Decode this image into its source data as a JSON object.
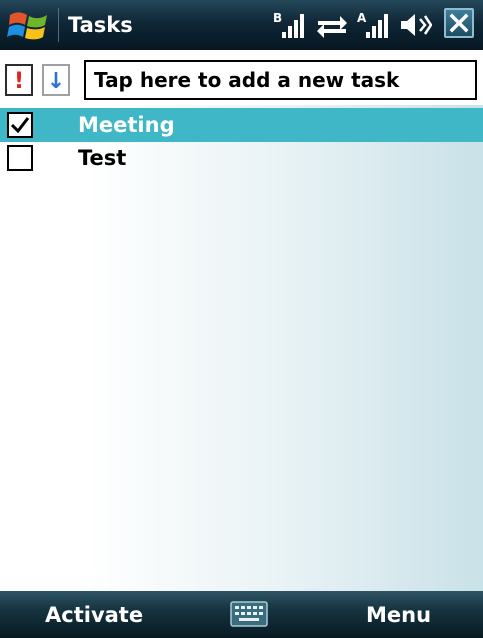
{
  "window": {
    "title": "Tasks"
  },
  "status_icons": [
    "windows-start-icon",
    "signal-strength-icon",
    "data-sync-icon",
    "signal-strength-icon",
    "volume-icon",
    "close-icon"
  ],
  "entry": {
    "placeholder": "Tap here to add a new task",
    "priority_high_symbol": "!",
    "priority_low_symbol": "↓"
  },
  "tasks": [
    {
      "label": "Meeting",
      "completed": true,
      "selected": true
    },
    {
      "label": "Test",
      "completed": false,
      "selected": false
    }
  ],
  "softkeys": {
    "left": "Activate",
    "right": "Menu"
  },
  "colors": {
    "selection": "#3fb7c6",
    "title_bar": "#0f2736",
    "priority_high": "#e0261b",
    "priority_low": "#2a73d6"
  }
}
